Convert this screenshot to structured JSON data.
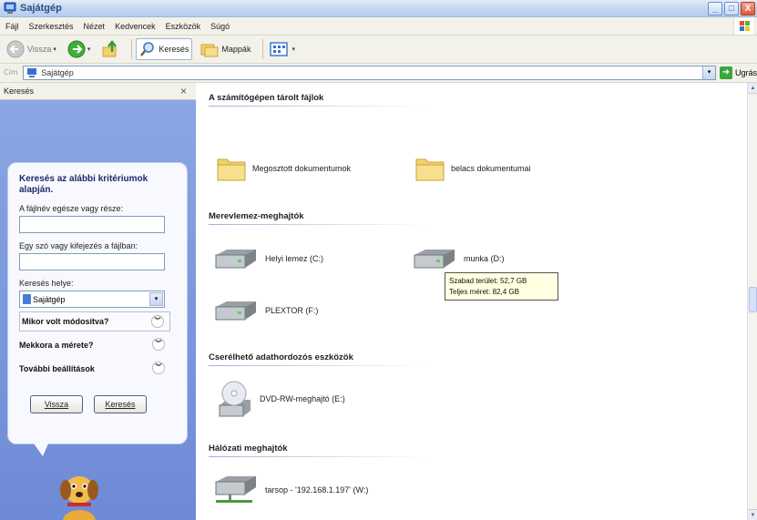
{
  "window": {
    "title": "Sajátgép",
    "buttons": [
      "_",
      "□",
      "X"
    ]
  },
  "menu": [
    "Fájl",
    "Szerkesztés",
    "Nézet",
    "Kedvencek",
    "Eszközök",
    "Súgó"
  ],
  "toolbar": {
    "back_label": "Vissza",
    "search_label": "Keresés",
    "folders_label": "Mappák"
  },
  "address": {
    "value": "Sajátgép",
    "go_label": "Ugrás"
  },
  "search_pane": {
    "header": "Keresés",
    "heading": "Keresés az alábbi kritériumok alapján.",
    "filename_label": "A fájlnév egésze vagy része:",
    "phrase_label": "Egy szó vagy kifejezés a fájlban:",
    "location_label": "Keresés helye:",
    "location_value": "Sajátgép",
    "options": [
      "Mikor volt módosítva?",
      "Mekkora a mérete?",
      "További beállítások"
    ],
    "back_button": "Vissza",
    "search_button": "Keresés"
  },
  "main": {
    "sections": [
      "A számítógépen tárolt fájlok",
      "Merevlemez-meghajtók",
      "Cserélhető adathordozós eszközök",
      "Hálózati meghajtók"
    ],
    "folders": [
      "Megosztott dokumentumok",
      "belacs dokumentumai"
    ],
    "drives": [
      "Helyi lemez (C:)",
      "munka (D:)",
      "PLEXTOR (F:)"
    ],
    "removable": [
      "DVD-RW-meghajtó (E:)"
    ],
    "network": [
      "tarsop - '192.168.1.197' (W:)"
    ]
  },
  "tooltip": {
    "free": "Szabad terület: 52,7 GB",
    "total": "Teljes méret: 82,4 GB"
  }
}
